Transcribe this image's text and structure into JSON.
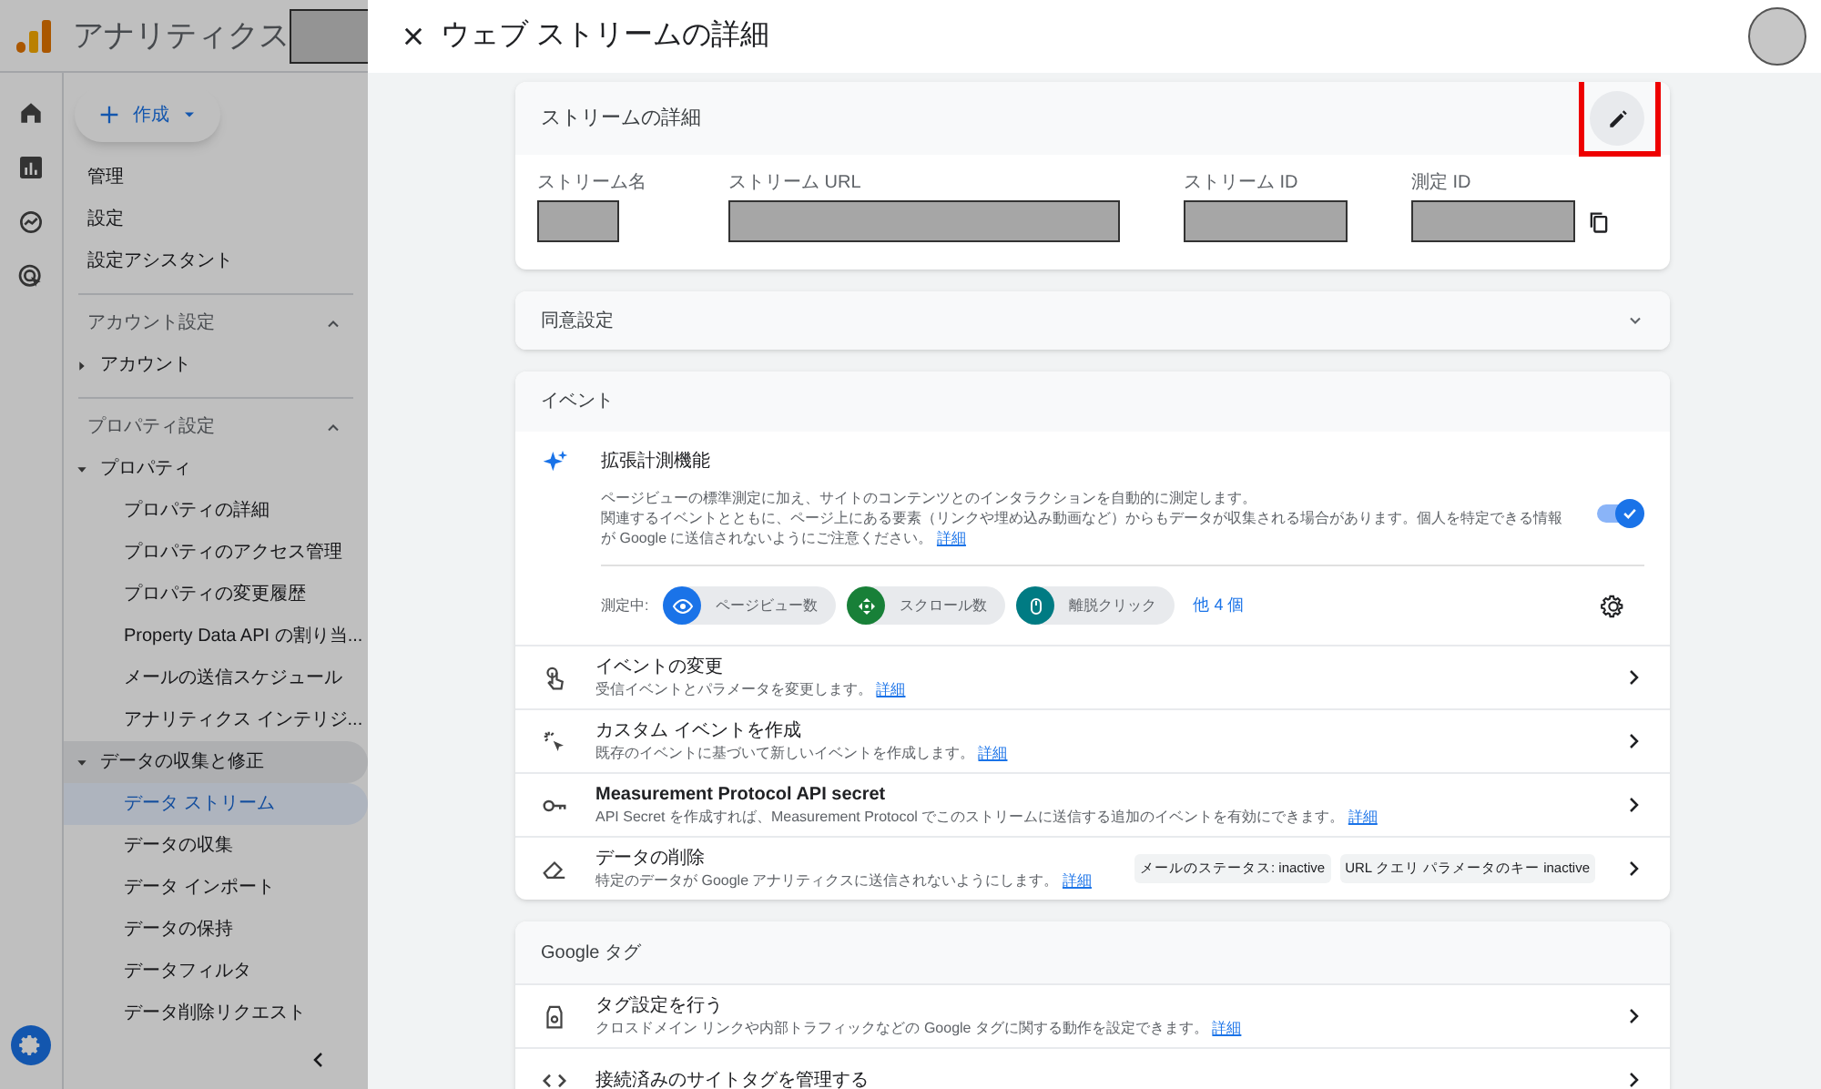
{
  "app": {
    "title": "アナリティクス",
    "create_button": "作成"
  },
  "nav": {
    "top_items": [
      "管理",
      "設定",
      "設定アシスタント"
    ],
    "sections": [
      {
        "label": "アカウント設定",
        "expanded": true,
        "items": [
          {
            "label": "アカウント",
            "expanded": false
          }
        ]
      },
      {
        "label": "プロパティ設定",
        "expanded": true,
        "items": [
          {
            "label": "プロパティ",
            "expanded": true,
            "children": [
              {
                "label": "プロパティの詳細",
                "selected": false
              },
              {
                "label": "プロパティのアクセス管理",
                "selected": false
              },
              {
                "label": "プロパティの変更履歴",
                "selected": false
              },
              {
                "label": "Property Data API の割り当...",
                "selected": false
              },
              {
                "label": "メールの送信スケジュール",
                "selected": false
              },
              {
                "label": "アナリティクス インテリジ...",
                "selected": false
              }
            ]
          },
          {
            "label": "データの収集と修正",
            "expanded": true,
            "children": [
              {
                "label": "データ ストリーム",
                "selected": true
              },
              {
                "label": "データの収集",
                "selected": false
              },
              {
                "label": "データ インポート",
                "selected": false
              },
              {
                "label": "データの保持",
                "selected": false
              },
              {
                "label": "データフィルタ",
                "selected": false
              },
              {
                "label": "データ削除リクエスト",
                "selected": false
              }
            ]
          }
        ]
      }
    ]
  },
  "panel": {
    "title": "ウェブ ストリームの詳細",
    "stream_details": {
      "title": "ストリームの詳細",
      "fields": [
        {
          "label": "ストリーム名"
        },
        {
          "label": "ストリーム URL"
        },
        {
          "label": "ストリーム ID"
        },
        {
          "label": "測定 ID"
        }
      ]
    },
    "consent": {
      "title": "同意設定",
      "expanded": false
    },
    "events": {
      "title": "イベント",
      "enhanced": {
        "title": "拡張計測機能",
        "description_lines": [
          "ページビューの標準測定に加え、サイトのコンテンツとのインタラクションを自動的に測定します。",
          "関連するイベントとともに、ページ上にある要素（リンクや埋め込み動画など）からもデータが収集される場合があります。個人を特定できる情報が Google に送信されないようにご注意ください。"
        ],
        "link": "詳細",
        "on": true,
        "measuring_label": "測定中:",
        "chips": [
          {
            "label": "ページビュー数",
            "kind": "eye",
            "color": "#1a73e8"
          },
          {
            "label": "スクロール数",
            "kind": "scroll",
            "color": "#188038"
          },
          {
            "label": "離脱クリック",
            "kind": "mouse",
            "color": "#007b83"
          }
        ],
        "more": "他 4 個"
      },
      "rows": [
        {
          "kind": "touch",
          "title": "イベントの変更",
          "description": "受信イベントとパラメータを変更します。",
          "link": "詳細"
        },
        {
          "kind": "sparkle",
          "title": "カスタム イベントを作成",
          "description": "既存のイベントに基づいて新しいイベントを作成します。",
          "link": "詳細"
        },
        {
          "kind": "key",
          "title": "Measurement Protocol API secret",
          "description": "API Secret を作成すれば、Measurement Protocol でこのストリームに送信する追加のイベントを有効にできます。",
          "link": "詳細"
        },
        {
          "kind": "eraser",
          "title": "データの削除",
          "description": "特定のデータが Google アナリティクスに送信されないようにします。",
          "link": "詳細",
          "tags": [
            "メールのステータス: inactive",
            "URL クエリ パラメータのキー inactive"
          ]
        }
      ]
    },
    "google_tag": {
      "title": "Google タグ",
      "rows": [
        {
          "kind": "tag",
          "title": "タグ設定を行う",
          "description": "クロスドメイン リンクや内部トラフィックなどの Google タグに関する動作を設定できます。",
          "link": "詳細"
        },
        {
          "kind": "code",
          "title": "接続済みのサイトタグを管理する"
        }
      ]
    }
  }
}
